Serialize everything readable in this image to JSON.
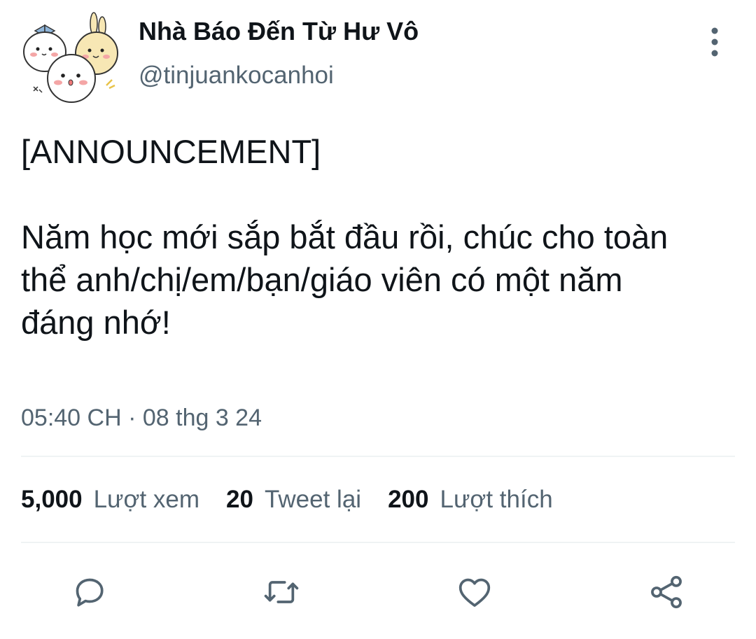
{
  "author": {
    "display_name": "Nhà Báo Đến Từ Hư Vô",
    "handle": "@tinjuankocanhoi"
  },
  "tweet": {
    "lines": [
      "[ANNOUNCEMENT]",
      "",
      "Năm học mới sắp bắt đầu rồi, chúc cho toàn",
      "thể anh/chị/em/bạn/giáo viên có một năm",
      "đáng nhớ!"
    ],
    "timestamp": "05:40 CH · 08 thg 3 24"
  },
  "stats": {
    "views_count": "5,000",
    "views_label": "Lượt xem",
    "retweets_count": "20",
    "retweets_label": "Tweet lại",
    "likes_count": "200",
    "likes_label": "Lượt thích"
  },
  "actions": [
    {
      "icon": "reply-icon"
    },
    {
      "icon": "retweet-icon"
    },
    {
      "icon": "like-icon"
    },
    {
      "icon": "share-icon"
    }
  ],
  "colors": {
    "text_primary": "#0f1419",
    "text_secondary": "#536471",
    "icon": "#536471",
    "divider": "#eff3f4"
  }
}
